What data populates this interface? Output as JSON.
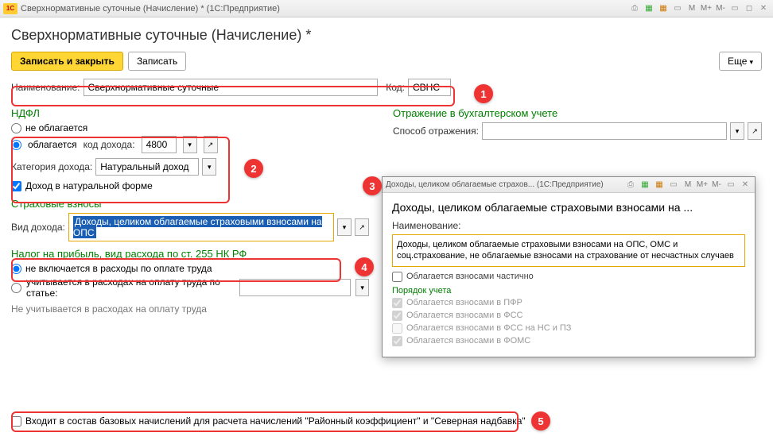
{
  "titlebar": {
    "logo": "1C",
    "text": "Сверхнормативные суточные (Начисление) *  (1С:Предприятие)"
  },
  "page_title": "Сверхнормативные суточные (Начисление) *",
  "toolbar": {
    "save_close": "Записать и закрыть",
    "save": "Записать",
    "more": "Еще"
  },
  "fields": {
    "name_label": "Наименование:",
    "name_value": "Сверхнормативные суточные",
    "code_label": "Код:",
    "code_value": "СВНС"
  },
  "ndfl": {
    "title": "НДФЛ",
    "not_taxed": "не облагается",
    "taxed": "облагается",
    "income_code_label": "код дохода:",
    "income_code_value": "4800",
    "category_label": "Категория дохода:",
    "category_value": "Натуральный доход",
    "natural_form": "Доход в натуральной форме"
  },
  "insurance": {
    "title": "Страховые взносы",
    "kind_label": "Вид дохода:",
    "kind_value": "Доходы, целиком облагаемые страховыми взносами на ОПС"
  },
  "profit_tax": {
    "title": "Налог на прибыль, вид расхода по ст. 255 НК РФ",
    "not_included": "не включается в расходы по оплате труда",
    "accounted": "учитывается в расходах на оплату труда по статье:",
    "note": "Не учитывается в расходах на оплату труда"
  },
  "accounting": {
    "title": "Отражение в бухгалтерском учете",
    "method_label": "Способ отражения:"
  },
  "footer": {
    "checkbox_label": "Входит в состав базовых начислений для расчета начислений \"Районный коэффициент\" и \"Северная надбавка\""
  },
  "popup": {
    "titlebar": "Доходы, целиком облагаемые страхов...   (1С:Предприятие)",
    "title": "Доходы, целиком облагаемые страховыми взносами на ...",
    "name_label": "Наименование:",
    "name_value": "Доходы, целиком облагаемые страховыми взносами на ОПС, ОМС и соц.страхование, не облагаемые взносами на страхование от несчастных случаев",
    "partial": "Облагается взносами частично",
    "order_title": "Порядок учета",
    "pfr": "Облагается взносами в ПФР",
    "fss": "Облагается взносами в ФСС",
    "fss_ns": "Облагается взносами в ФСС на НС и ПЗ",
    "foms": "Облагается взносами в ФОМС"
  },
  "badges": {
    "b1": "1",
    "b2": "2",
    "b3": "3",
    "b4": "4",
    "b5": "5"
  }
}
